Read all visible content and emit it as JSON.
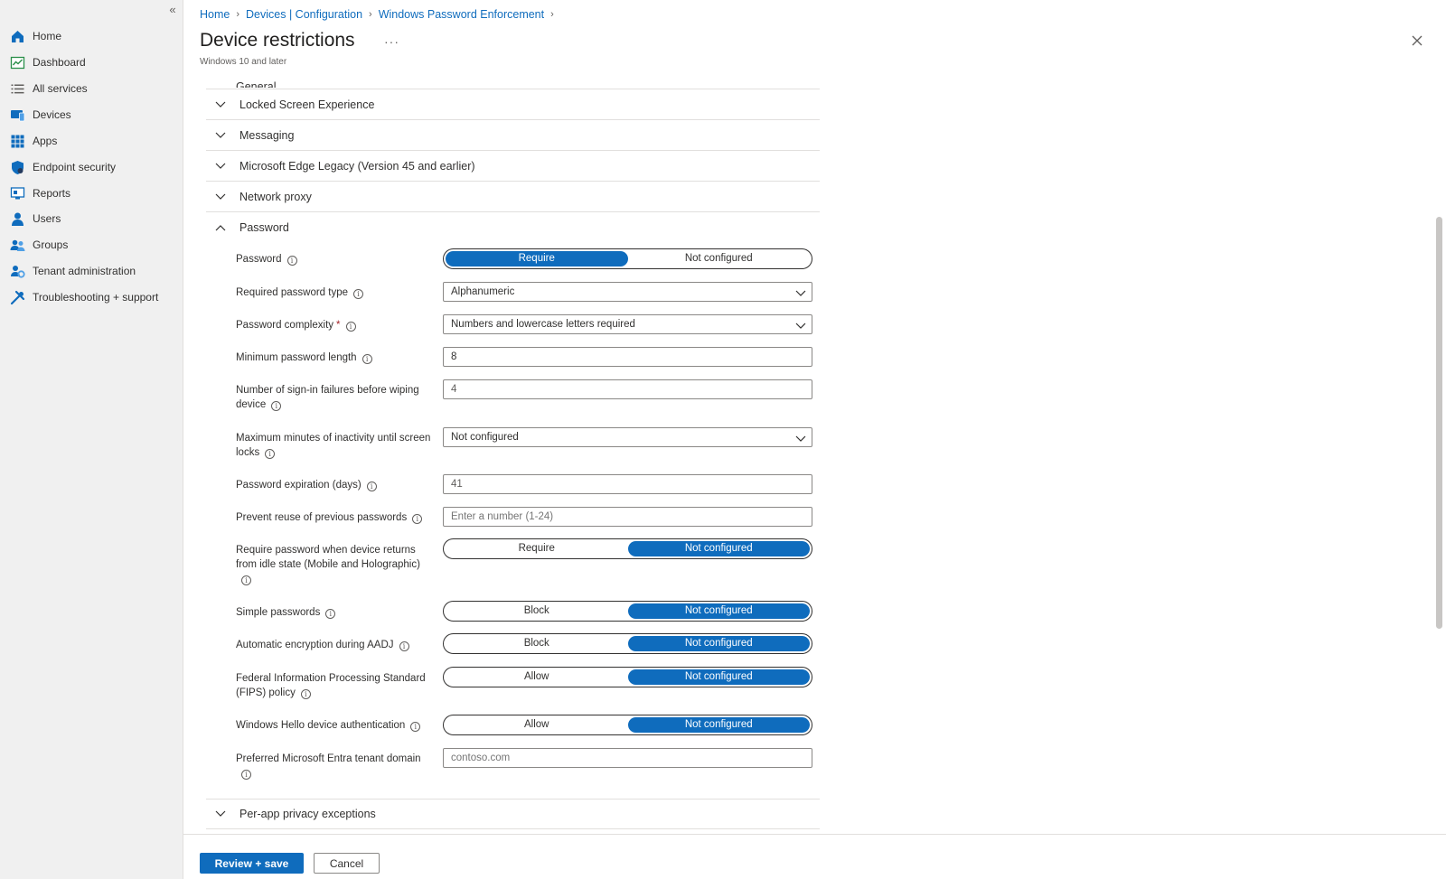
{
  "sidebar": {
    "collapse_label": "«",
    "items": [
      {
        "label": "Home",
        "icon": "home-icon"
      },
      {
        "label": "Dashboard",
        "icon": "dashboard-icon"
      },
      {
        "label": "All services",
        "icon": "list-icon"
      },
      {
        "label": "Devices",
        "icon": "devices-icon"
      },
      {
        "label": "Apps",
        "icon": "apps-icon"
      },
      {
        "label": "Endpoint security",
        "icon": "shield-icon"
      },
      {
        "label": "Reports",
        "icon": "reports-icon"
      },
      {
        "label": "Users",
        "icon": "user-icon"
      },
      {
        "label": "Groups",
        "icon": "groups-icon"
      },
      {
        "label": "Tenant administration",
        "icon": "tenant-admin-icon"
      },
      {
        "label": "Troubleshooting + support",
        "icon": "wrench-icon"
      }
    ]
  },
  "breadcrumb": [
    "Home",
    "Devices | Configuration",
    "Windows Password Enforcement"
  ],
  "header": {
    "title": "Device restrictions",
    "more": "···",
    "subtitle": "Windows 10 and later"
  },
  "sections": {
    "general": "General",
    "locked_screen": "Locked Screen Experience",
    "messaging": "Messaging",
    "edge_legacy": "Microsoft Edge Legacy (Version 45 and earlier)",
    "network_proxy": "Network proxy",
    "password": "Password",
    "per_app_privacy": "Per-app privacy exceptions"
  },
  "password": {
    "password": {
      "label": "Password",
      "options": [
        "Require",
        "Not configured"
      ],
      "selected": "Require"
    },
    "required_type": {
      "label": "Required password type",
      "value": "Alphanumeric"
    },
    "complexity": {
      "label": "Password complexity",
      "required_mark": "*",
      "value": "Numbers and lowercase letters required"
    },
    "min_length": {
      "label": "Minimum password length",
      "value": "8"
    },
    "signin_failures": {
      "label": "Number of sign-in failures before wiping device",
      "value": "4"
    },
    "max_inactivity": {
      "label": "Maximum minutes of inactivity until screen locks",
      "value": "Not configured"
    },
    "expiration": {
      "label": "Password expiration (days)",
      "value": "41"
    },
    "prevent_reuse": {
      "label": "Prevent reuse of previous passwords",
      "value": "",
      "placeholder": "Enter a number (1-24)"
    },
    "idle_return": {
      "label": "Require password when device returns from idle state (Mobile and Holographic)",
      "options": [
        "Require",
        "Not configured"
      ],
      "selected": "Not configured"
    },
    "simple_passwords": {
      "label": "Simple passwords",
      "options": [
        "Block",
        "Not configured"
      ],
      "selected": "Not configured"
    },
    "auto_encryption": {
      "label": "Automatic encryption during AADJ",
      "options": [
        "Block",
        "Not configured"
      ],
      "selected": "Not configured"
    },
    "fips": {
      "label": "Federal Information Processing Standard (FIPS) policy",
      "options": [
        "Allow",
        "Not configured"
      ],
      "selected": "Not configured"
    },
    "hello_auth": {
      "label": "Windows Hello device authentication",
      "options": [
        "Allow",
        "Not configured"
      ],
      "selected": "Not configured"
    },
    "entra_domain": {
      "label": "Preferred Microsoft Entra tenant domain",
      "value": "",
      "placeholder": "contoso.com"
    }
  },
  "footer": {
    "review_save": "Review + save",
    "cancel": "Cancel"
  },
  "colors": {
    "accent": "#0f6cbd",
    "sidebar_bg": "#f0f0f0"
  }
}
